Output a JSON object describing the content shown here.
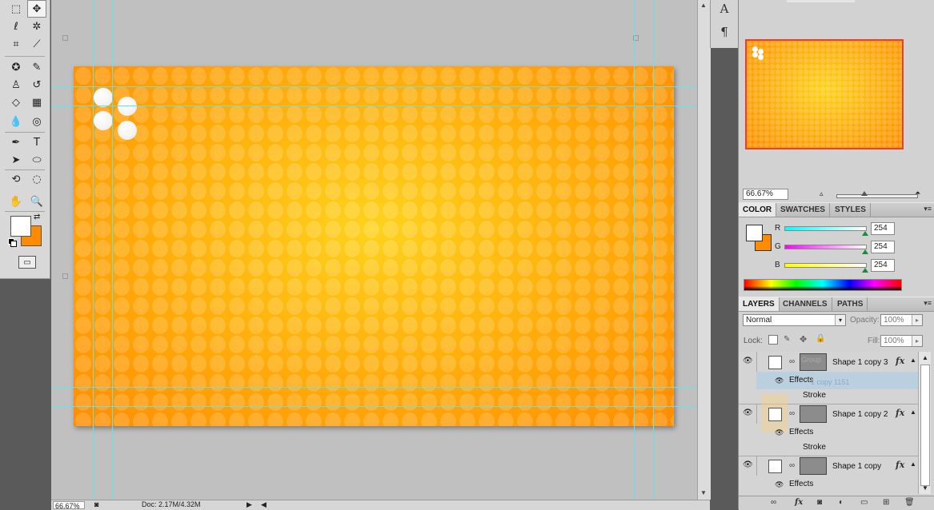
{
  "toolbox": {
    "tools": [
      {
        "name": "marquee-icon",
        "glyph": "⬚"
      },
      {
        "name": "move-icon",
        "glyph": "✥",
        "active": true
      },
      {
        "name": "lasso-icon",
        "glyph": "ℓ"
      },
      {
        "name": "magic-wand-icon",
        "glyph": "✲"
      },
      {
        "name": "crop-icon",
        "glyph": "⌗"
      },
      {
        "name": "eyedropper-icon",
        "glyph": "⟋"
      },
      {
        "name": "healing-brush-icon",
        "glyph": "✪"
      },
      {
        "name": "brush-icon",
        "glyph": "✎"
      },
      {
        "name": "clone-stamp-icon",
        "glyph": "♙"
      },
      {
        "name": "history-brush-icon",
        "glyph": "↺"
      },
      {
        "name": "eraser-icon",
        "glyph": "◇"
      },
      {
        "name": "gradient-icon",
        "glyph": "▦"
      },
      {
        "name": "blur-icon",
        "glyph": "💧"
      },
      {
        "name": "dodge-icon",
        "glyph": "◎"
      },
      {
        "name": "pen-icon",
        "glyph": "✒"
      },
      {
        "name": "type-icon",
        "glyph": "T"
      },
      {
        "name": "path-selection-icon",
        "glyph": "➤"
      },
      {
        "name": "ellipse-shape-icon",
        "glyph": "⬭"
      },
      {
        "name": "3d-rotate-icon",
        "glyph": "⟲"
      },
      {
        "name": "3d-orbit-icon",
        "glyph": "◌"
      },
      {
        "name": "hand-icon",
        "glyph": "✋"
      },
      {
        "name": "zoom-icon",
        "glyph": "🔍"
      }
    ],
    "quick_mask_glyph": "▭"
  },
  "statusbar": {
    "zoom": "66.67%",
    "doc_info": "Doc: 2.17M/4.32M"
  },
  "panel_strip": {
    "char_glyph": "A",
    "para_glyph": "¶"
  },
  "navigator": {
    "zoom": "66.67%",
    "zoom_out_glyph": "▵",
    "zoom_in_glyph": "⏶"
  },
  "color_panel": {
    "tabs": [
      "COLOR",
      "SWATCHES",
      "STYLES"
    ],
    "r_label": "R",
    "g_label": "G",
    "b_label": "B",
    "r": "254",
    "g": "254",
    "b": "254",
    "fg_color": "#ffffff",
    "bg_color": "#ff8c00"
  },
  "layers_panel": {
    "tabs": [
      "LAYERS",
      "CHANNELS",
      "PATHS"
    ],
    "blend_mode": "Normal",
    "opacity_label": "Opacity:",
    "opacity": "100%",
    "lock_label": "Lock:",
    "fill_label": "Fill:",
    "fill": "100%",
    "layers": [
      {
        "name": "Shape 1 copy 3",
        "effects_label": "Effects",
        "stroke_label": "Stroke"
      },
      {
        "name": "Shape 1 copy 2",
        "effects_label": "Effects",
        "stroke_label": "Stroke"
      },
      {
        "name": "Shape 1 copy",
        "effects_label": "Effects"
      }
    ],
    "ghost_label": "Group",
    "ghost_drag_label": "1 copy 1151",
    "fx_glyph": "fx"
  },
  "colors": {
    "canvas_orange": "#ff8c00",
    "canvas_yellow": "#ffd21c",
    "guide": "#5ee6ec",
    "nav_border": "#e3423a"
  }
}
